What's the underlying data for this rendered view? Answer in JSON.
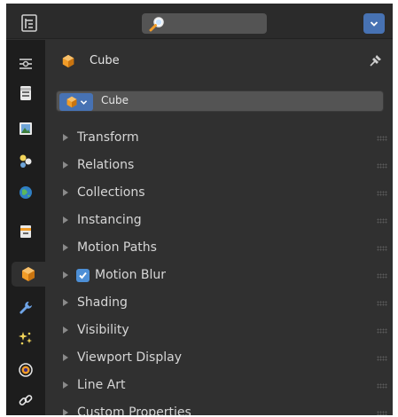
{
  "header": {
    "editor_type_icon": "properties-editor-icon",
    "search_icon": "magnifier-icon",
    "search_value": "",
    "options_icon": "chevron-down-icon"
  },
  "tabs": [
    {
      "name": "tool",
      "icon": "tool-settings-icon"
    },
    {
      "name": "render",
      "icon": "render-icon"
    },
    {
      "name": "output",
      "icon": "output-icon"
    },
    {
      "name": "view-layer",
      "icon": "view-layer-icon"
    },
    {
      "name": "scene",
      "icon": "scene-icon"
    },
    {
      "name": "world",
      "icon": "world-icon"
    },
    {
      "name": "collection",
      "icon": "collection-icon"
    },
    {
      "name": "object",
      "icon": "object-cube-icon",
      "active": true
    },
    {
      "name": "modifiers",
      "icon": "wrench-icon"
    },
    {
      "name": "particles",
      "icon": "particles-icon"
    },
    {
      "name": "physics",
      "icon": "physics-icon"
    },
    {
      "name": "constraints",
      "icon": "constraint-icon"
    }
  ],
  "object": {
    "title": "Cube",
    "name_field": "Cube",
    "pin_icon": "pin-icon"
  },
  "panels": [
    {
      "label": "Transform"
    },
    {
      "label": "Relations"
    },
    {
      "label": "Collections"
    },
    {
      "label": "Instancing"
    },
    {
      "label": "Motion Paths"
    },
    {
      "label": "Motion Blur",
      "checkbox": true,
      "checked": true
    },
    {
      "label": "Shading"
    },
    {
      "label": "Visibility"
    },
    {
      "label": "Viewport Display"
    },
    {
      "label": "Line Art"
    },
    {
      "label": "Custom Properties"
    }
  ],
  "colors": {
    "accent": "#4772b3",
    "checkbox": "#4d8fd6",
    "object_orange": "#f19c28",
    "background": "#303030",
    "tab_bar": "#1d1d1d"
  }
}
